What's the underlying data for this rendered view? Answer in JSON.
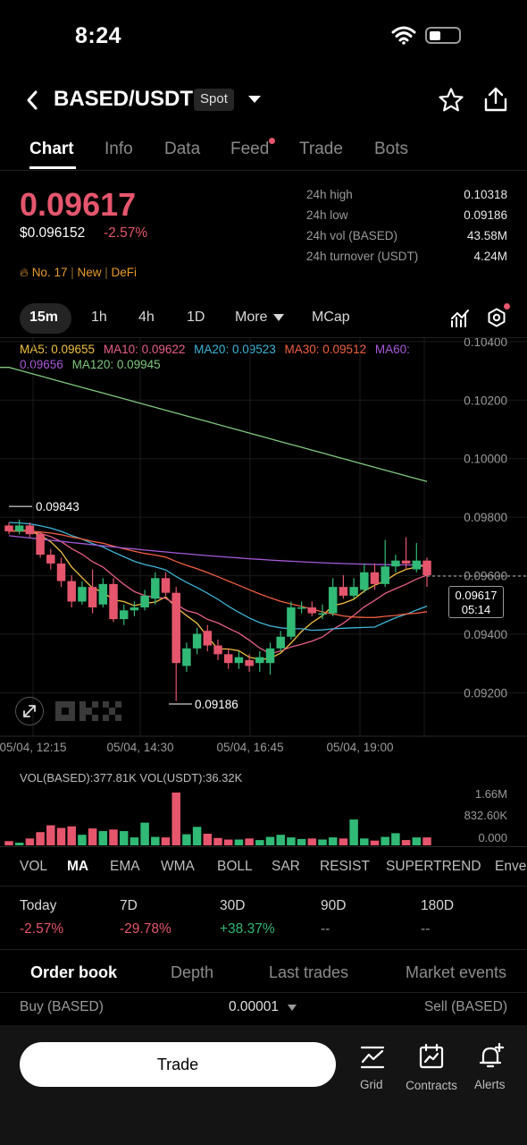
{
  "status": {
    "time": "8:24"
  },
  "header": {
    "pair": "BASED/USDT",
    "badge": "Spot"
  },
  "tabs": [
    {
      "label": "Chart"
    },
    {
      "label": "Info"
    },
    {
      "label": "Data"
    },
    {
      "label": "Feed"
    },
    {
      "label": "Trade"
    },
    {
      "label": "Bots"
    }
  ],
  "price": {
    "last": "0.09617",
    "usd": "$0.096152",
    "change": "-2.57%"
  },
  "stats": [
    {
      "label": "24h high",
      "value": "0.10318"
    },
    {
      "label": "24h low",
      "value": "0.09186"
    },
    {
      "label": "24h vol (BASED)",
      "value": "43.58M"
    },
    {
      "label": "24h turnover (USDT)",
      "value": "4.24M"
    }
  ],
  "tags": {
    "rank": "No. 17",
    "new": "New",
    "category": "DeFi"
  },
  "timeframes": {
    "tf_15m": "15m",
    "tf_1h": "1h",
    "tf_4h": "4h",
    "tf_1d": "1D",
    "more": "More",
    "mcap": "MCap"
  },
  "ma_legend": {
    "ma5": "MA5: 0.09655",
    "ma10": "MA10: 0.09622",
    "ma20": "MA20: 0.09523",
    "ma30": "MA30: 0.09512",
    "ma60_a": "MA60:",
    "ma60_b": "0.09656",
    "ma120": "MA120: 0.09945"
  },
  "colors": {
    "up": "#31b976",
    "down": "#e5566d",
    "ma5": "#f0c040",
    "ma10": "#e8608a",
    "ma20": "#3fb5d8",
    "ma30": "#f06040",
    "ma60": "#a55ad8",
    "ma120": "#7ec97e"
  },
  "chart_data": {
    "type": "candlestick",
    "y_ticks": [
      "0.10400",
      "0.10200",
      "0.10000",
      "0.09800",
      "0.09600",
      "0.09400",
      "0.09200"
    ],
    "x_ticks": [
      "05/04, 12:15",
      "05/04, 14:30",
      "05/04, 16:45",
      "05/04, 19:00"
    ],
    "ylim": [
      0.0907,
      0.1043
    ],
    "annotations": {
      "high": "0.09843",
      "low": "0.09186"
    },
    "current": {
      "price": "0.09617",
      "countdown": "05:14"
    },
    "candles": [
      [
        0.0979,
        0.0977,
        0.098,
        0.0976
      ],
      [
        0.0977,
        0.0979,
        0.0981,
        0.0976
      ],
      [
        0.0979,
        0.0976,
        0.098,
        0.0975
      ],
      [
        0.0976,
        0.0969,
        0.0977,
        0.0968
      ],
      [
        0.0969,
        0.0966,
        0.0971,
        0.0964
      ],
      [
        0.0966,
        0.096,
        0.0968,
        0.0958
      ],
      [
        0.096,
        0.0953,
        0.0962,
        0.0951
      ],
      [
        0.0953,
        0.0958,
        0.096,
        0.0952
      ],
      [
        0.0958,
        0.0951,
        0.0964,
        0.0949
      ],
      [
        0.0952,
        0.0959,
        0.0961,
        0.0951
      ],
      [
        0.0959,
        0.0947,
        0.0961,
        0.0946
      ],
      [
        0.0947,
        0.095,
        0.0952,
        0.0945
      ],
      [
        0.095,
        0.0951,
        0.0953,
        0.0948
      ],
      [
        0.0951,
        0.0955,
        0.0957,
        0.095
      ],
      [
        0.0954,
        0.0961,
        0.0963,
        0.0952
      ],
      [
        0.0961,
        0.0956,
        0.0963,
        0.0955
      ],
      [
        0.0956,
        0.0932,
        0.0958,
        0.0919
      ],
      [
        0.0931,
        0.0937,
        0.0939,
        0.0929
      ],
      [
        0.0937,
        0.0942,
        0.0944,
        0.0935
      ],
      [
        0.0943,
        0.0938,
        0.0945,
        0.0936
      ],
      [
        0.0938,
        0.0935,
        0.094,
        0.0933
      ],
      [
        0.0935,
        0.0932,
        0.0937,
        0.093
      ],
      [
        0.0932,
        0.0934,
        0.0936,
        0.093
      ],
      [
        0.0933,
        0.0931,
        0.0935,
        0.0929
      ],
      [
        0.0932,
        0.0934,
        0.0936,
        0.0929
      ],
      [
        0.0932,
        0.0937,
        0.0939,
        0.0928
      ],
      [
        0.0937,
        0.0941,
        0.0943,
        0.0936
      ],
      [
        0.0941,
        0.0951,
        0.0953,
        0.094
      ],
      [
        0.0951,
        0.0951,
        0.0953,
        0.0949
      ],
      [
        0.0951,
        0.0949,
        0.0953,
        0.0948
      ],
      [
        0.0949,
        0.0949,
        0.0952,
        0.0947
      ],
      [
        0.0949,
        0.0958,
        0.0961,
        0.0948
      ],
      [
        0.0958,
        0.0955,
        0.0962,
        0.0954
      ],
      [
        0.0955,
        0.0958,
        0.0961,
        0.0954
      ],
      [
        0.0957,
        0.0963,
        0.0966,
        0.0956
      ],
      [
        0.0963,
        0.0959,
        0.0966,
        0.0957
      ],
      [
        0.0959,
        0.0965,
        0.0974,
        0.0958
      ],
      [
        0.0965,
        0.0967,
        0.0969,
        0.0963
      ],
      [
        0.0967,
        0.0966,
        0.0975,
        0.0964
      ],
      [
        0.0964,
        0.0967,
        0.0973,
        0.0963
      ],
      [
        0.0967,
        0.0962,
        0.0968,
        0.0958
      ]
    ],
    "volume": {
      "label_based": "VOL(BASED):377.81K",
      "label_usdt": "VOL(USDT):36.32K",
      "y_ticks": [
        "1.66M",
        "832.60K",
        "0.000"
      ],
      "max": 1660000,
      "bars": [
        0.08,
        0.05,
        0.13,
        0.25,
        0.38,
        0.33,
        0.36,
        0.2,
        0.32,
        0.27,
        0.3,
        0.27,
        0.15,
        0.43,
        0.16,
        0.15,
        1.0,
        0.21,
        0.35,
        0.22,
        0.14,
        0.11,
        0.11,
        0.13,
        0.1,
        0.16,
        0.2,
        0.15,
        0.12,
        0.13,
        0.11,
        0.15,
        0.13,
        0.49,
        0.13,
        0.09,
        0.16,
        0.23,
        0.1,
        0.15,
        0.15
      ]
    }
  },
  "indicators": [
    "VOL",
    "MA",
    "EMA",
    "WMA",
    "BOLL",
    "SAR",
    "RESIST",
    "SUPERTREND",
    "Enve"
  ],
  "performance": [
    {
      "label": "Today",
      "value": "-2.57%"
    },
    {
      "label": "7D",
      "value": "-29.78%"
    },
    {
      "label": "30D",
      "value": "+38.37%"
    },
    {
      "label": "90D",
      "value": "--"
    },
    {
      "label": "180D",
      "value": "--"
    }
  ],
  "orderbook": {
    "tabs": [
      "Order book",
      "Depth",
      "Last trades",
      "Market events"
    ],
    "buy_label": "Buy (BASED)",
    "tick": "0.00001",
    "sell_label": "Sell (BASED)"
  },
  "bottom": {
    "trade": "Trade",
    "grid": "Grid",
    "contracts": "Contracts",
    "alerts": "Alerts"
  }
}
